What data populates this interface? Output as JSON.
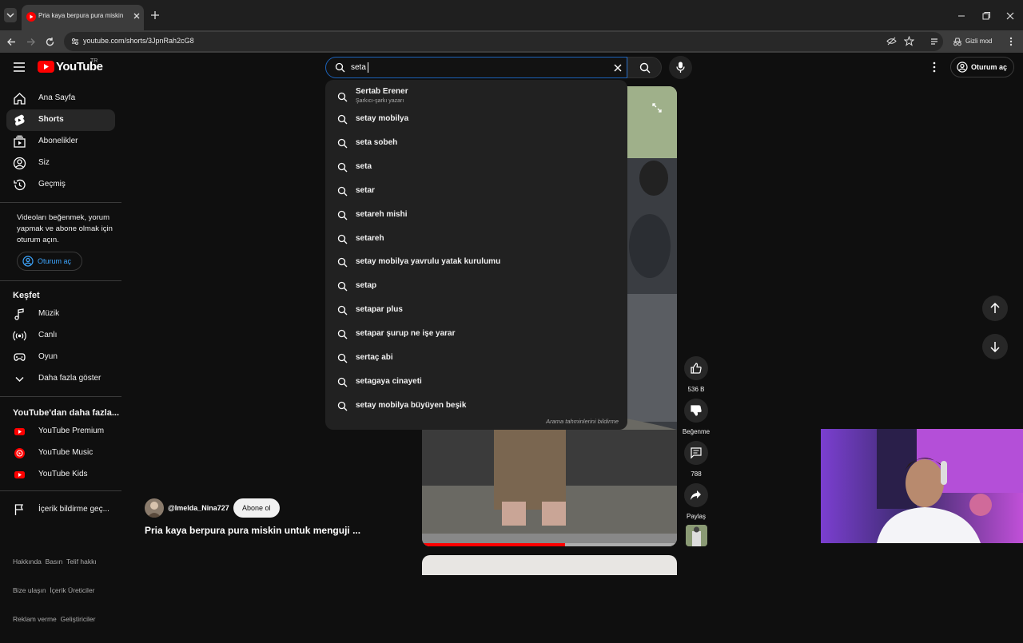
{
  "browser": {
    "tab_title": "Pria kaya berpura pura miskin u",
    "url": "youtube.com/shorts/3JpnRah2cG8",
    "incognito_label": "Gizli mod"
  },
  "header": {
    "logo_text": "YouTube",
    "region": "TR",
    "search_value": "seta",
    "signin_label": "Oturum aç"
  },
  "sidebar": {
    "items": [
      {
        "label": "Ana Sayfa",
        "icon": "home-icon"
      },
      {
        "label": "Shorts",
        "icon": "shorts-icon"
      },
      {
        "label": "Abonelikler",
        "icon": "subscriptions-icon"
      },
      {
        "label": "Siz",
        "icon": "you-icon"
      },
      {
        "label": "Geçmiş",
        "icon": "history-icon"
      }
    ],
    "signin_prompt": "Videoları beğenmek, yorum yapmak ve abone olmak için oturum açın.",
    "signin_button": "Oturum aç",
    "explore_title": "Keşfet",
    "explore_items": [
      {
        "label": "Müzik",
        "icon": "music-icon"
      },
      {
        "label": "Canlı",
        "icon": "live-icon"
      },
      {
        "label": "Oyun",
        "icon": "gaming-icon"
      },
      {
        "label": "Daha fazla göster",
        "icon": "chevron-down-icon"
      }
    ],
    "more_title": "YouTube'dan daha fazla...",
    "more_items": [
      {
        "label": "YouTube Premium",
        "icon": "youtube-premium-icon"
      },
      {
        "label": "YouTube Music",
        "icon": "youtube-music-icon"
      },
      {
        "label": "YouTube Kids",
        "icon": "youtube-kids-icon"
      }
    ],
    "report_label": "İçerik bildirme geç...",
    "footer_line1": "Hakkında  Basın  Telif hakkı",
    "footer_line2": "Bize ulaşın  İçerik Üreticiler",
    "footer_line3": "Reklam verme  Geliştiriciler"
  },
  "suggestions": {
    "top": {
      "title": "Sertab Erener",
      "subtitle": "Şarkıcı-şarkı yazarı"
    },
    "items": [
      "setay mobilya",
      "seta sobeh",
      "seta",
      "setar",
      "setareh mishi",
      "setareh",
      "setay mobilya yavrulu yatak kurulumu",
      "setap",
      "setapar plus",
      "setapar şurup ne işe yarar",
      "sertaç abi",
      "setagaya cinayeti",
      "setay mobilya büyüyen beşik"
    ],
    "report_link": "Arama tahminlerini bildirme"
  },
  "short": {
    "channel": "@Imelda_Nina727",
    "subscribe_label": "Abone ol",
    "title": "Pria kaya berpura pura miskin untuk menguji ...",
    "likes": "536 B",
    "dislike_label": "Beğenme",
    "comments": "788",
    "share_label": "Paylaş"
  },
  "colors": {
    "bg": "#0f0f0f",
    "accent_red": "#ff0000",
    "search_focus": "#1c62b9",
    "link_blue": "#3ea6ff"
  }
}
